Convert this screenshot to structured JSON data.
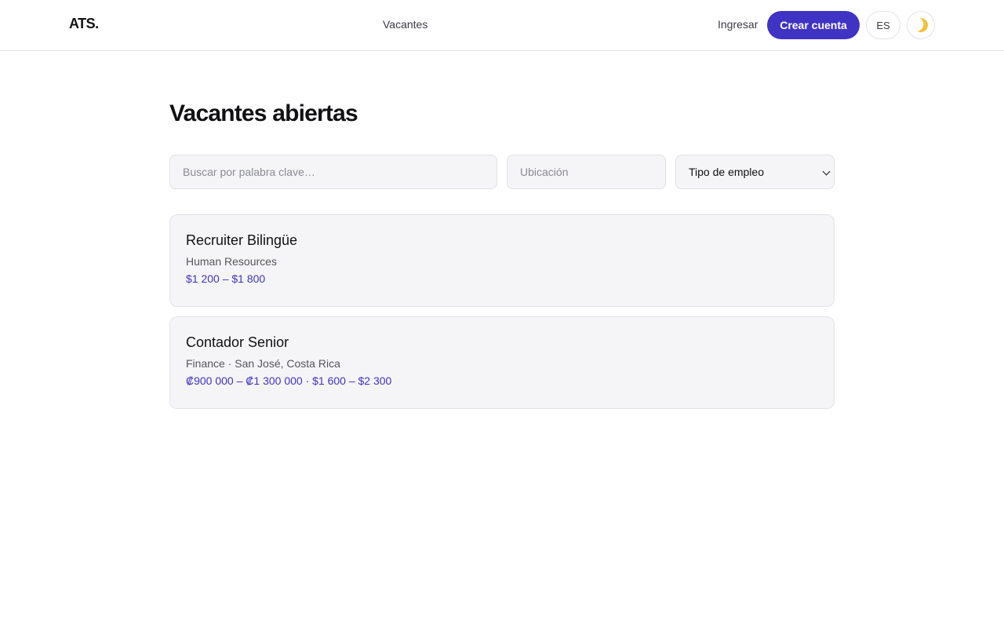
{
  "header": {
    "logo": "ATS.",
    "nav_vacancies": "Vacantes",
    "login": "Ingresar",
    "signup": "Crear cuenta",
    "language": "ES",
    "theme_icon": "moon-icon"
  },
  "main": {
    "title": "Vacantes abiertas",
    "search_placeholder": "Buscar por palabra clave…",
    "location_placeholder": "Ubicación",
    "employment_type": "Tipo de empleo"
  },
  "jobs": [
    {
      "title": "Recruiter Bilingüe",
      "meta": "Human Resources",
      "salary": "$1 200 – $1 800"
    },
    {
      "title": "Contador Senior",
      "meta": "Finance · San José, Costa Rica",
      "salary": "₡900 000 – ₡1 300 000 · $1 600 – $2 300"
    }
  ],
  "colors": {
    "accent": "#3f33c4",
    "card_bg": "#f5f5f7",
    "border": "#e3e3e8"
  }
}
